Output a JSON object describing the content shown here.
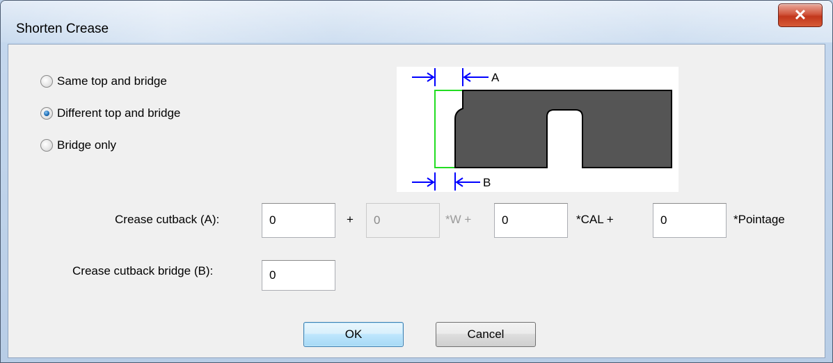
{
  "window": {
    "title": "Shorten Crease",
    "close_symbol": "✕"
  },
  "options": [
    {
      "label": "Same top and bridge",
      "checked": false
    },
    {
      "label": "Different top and bridge",
      "checked": true
    },
    {
      "label": "Bridge only",
      "checked": false
    }
  ],
  "diagram": {
    "label_a": "A",
    "label_b": "B"
  },
  "cutback": {
    "label": "Crease cutback (A):",
    "value_1": "0",
    "plus": "+",
    "value_w": "0",
    "w_suffix": "*W +",
    "value_cal": "0",
    "cal_suffix": "*CAL +",
    "value_pointage": "0",
    "pointage_suffix": "*Pointage"
  },
  "bridge": {
    "label": "Crease cutback bridge (B):",
    "value": "0"
  },
  "buttons": {
    "ok": "OK",
    "cancel": "Cancel"
  }
}
